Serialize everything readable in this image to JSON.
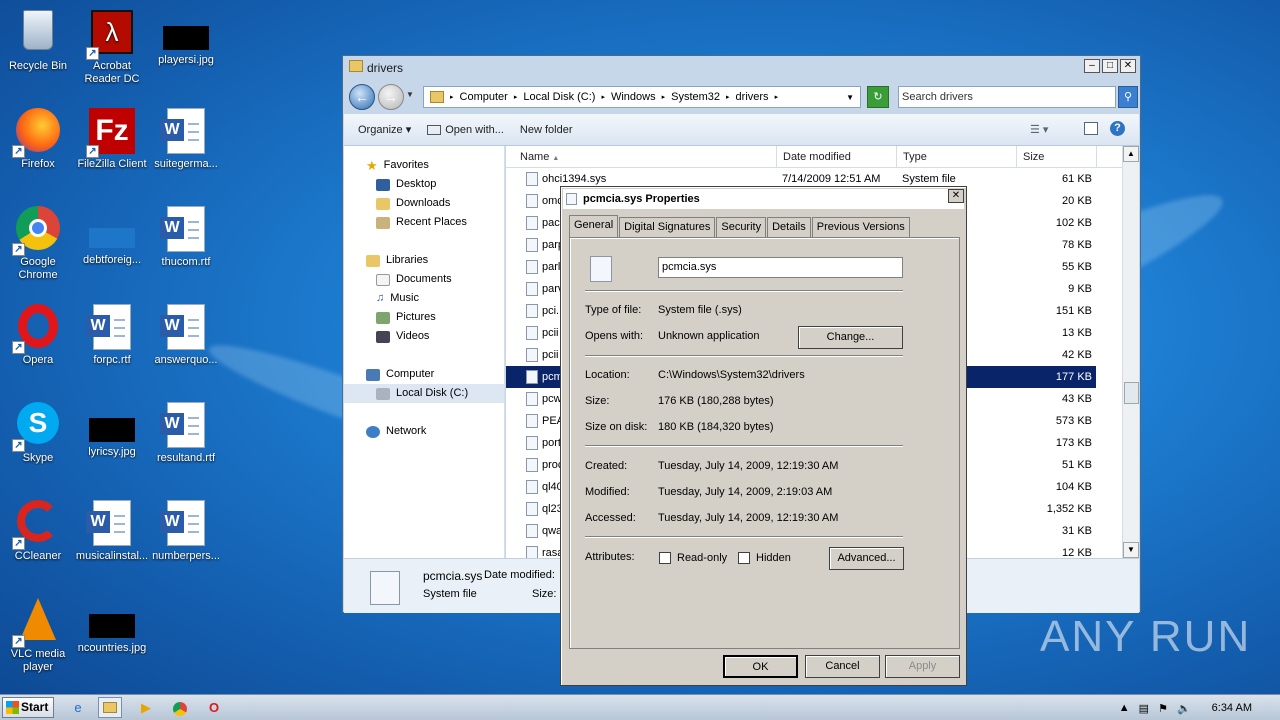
{
  "desktop": {
    "icons": [
      {
        "label": "Recycle Bin"
      },
      {
        "label": "Acrobat Reader DC"
      },
      {
        "label": "playersi.jpg"
      },
      {
        "label": "Firefox"
      },
      {
        "label": "FileZilla Client"
      },
      {
        "label": "suitegerma..."
      },
      {
        "label": "Google Chrome"
      },
      {
        "label": "debtforeig..."
      },
      {
        "label": "thucom.rtf"
      },
      {
        "label": "Opera"
      },
      {
        "label": "forpc.rtf"
      },
      {
        "label": "answerquo..."
      },
      {
        "label": "Skype"
      },
      {
        "label": "lyricsy.jpg"
      },
      {
        "label": "resultand.rtf"
      },
      {
        "label": "CCleaner"
      },
      {
        "label": "musicalinstal..."
      },
      {
        "label": "numberpers..."
      },
      {
        "label": "VLC media player"
      },
      {
        "label": "ncountries.jpg"
      }
    ]
  },
  "explorer": {
    "title": "drivers",
    "breadcrumb": [
      "Computer",
      "Local Disk (C:)",
      "Windows",
      "System32",
      "drivers"
    ],
    "search_placeholder": "Search drivers",
    "toolbar": {
      "organize": "Organize",
      "open_with": "Open with...",
      "new_folder": "New folder"
    },
    "nav": {
      "favorites": "Favorites",
      "desktop": "Desktop",
      "downloads": "Downloads",
      "recent": "Recent Places",
      "libraries": "Libraries",
      "documents": "Documents",
      "music": "Music",
      "pictures": "Pictures",
      "videos": "Videos",
      "computer": "Computer",
      "local_disk": "Local Disk (C:)",
      "network": "Network"
    },
    "columns": {
      "name": "Name",
      "date": "Date modified",
      "type": "Type",
      "size": "Size"
    },
    "rows": [
      {
        "name": "ohci1394.sys",
        "date": "7/14/2009 12:51 AM",
        "type": "System file",
        "size": "61 KB"
      },
      {
        "name": "omc",
        "date": "",
        "type": "",
        "size": "20 KB"
      },
      {
        "name": "pac",
        "date": "",
        "type": "",
        "size": "102 KB"
      },
      {
        "name": "parp",
        "date": "",
        "type": "",
        "size": "78 KB"
      },
      {
        "name": "parl",
        "date": "",
        "type": "",
        "size": "55 KB"
      },
      {
        "name": "parv",
        "date": "",
        "type": "",
        "size": "9 KB"
      },
      {
        "name": "pci.",
        "date": "",
        "type": "",
        "size": "151 KB"
      },
      {
        "name": "pcii",
        "date": "",
        "type": "",
        "size": "13 KB"
      },
      {
        "name": "pcii",
        "date": "",
        "type": "",
        "size": "42 KB"
      },
      {
        "name": "pcm",
        "date": "",
        "type": "",
        "size": "177 KB"
      },
      {
        "name": "pcw",
        "date": "",
        "type": "",
        "size": "43 KB"
      },
      {
        "name": "PEA",
        "date": "",
        "type": "",
        "size": "573 KB"
      },
      {
        "name": "port",
        "date": "",
        "type": "",
        "size": "173 KB"
      },
      {
        "name": "proc",
        "date": "",
        "type": "",
        "size": "51 KB"
      },
      {
        "name": "ql40",
        "date": "",
        "type": "",
        "size": "104 KB"
      },
      {
        "name": "ql23",
        "date": "",
        "type": "",
        "size": "1,352 KB"
      },
      {
        "name": "qwa",
        "date": "",
        "type": "",
        "size": "31 KB"
      },
      {
        "name": "rasa",
        "date": "",
        "type": "",
        "size": "12 KB"
      }
    ],
    "details": {
      "name": "pcmcia.sys",
      "date_label": "Date modified:",
      "type": "System file",
      "size_label": "Size:"
    }
  },
  "dialog": {
    "title": "pcmcia.sys Properties",
    "tabs": [
      "General",
      "Digital Signatures",
      "Security",
      "Details",
      "Previous Versions"
    ],
    "filename": "pcmcia.sys",
    "type_label": "Type of file:",
    "type_value": "System file (.sys)",
    "opens_label": "Opens with:",
    "opens_value": "Unknown application",
    "change": "Change...",
    "location_label": "Location:",
    "location_value": "C:\\Windows\\System32\\drivers",
    "size_label": "Size:",
    "size_value": "176 KB (180,288 bytes)",
    "disk_label": "Size on disk:",
    "disk_value": "180 KB (184,320 bytes)",
    "created_label": "Created:",
    "created_value": "Tuesday, July 14, 2009, 12:19:30 AM",
    "modified_label": "Modified:",
    "modified_value": "Tuesday, July 14, 2009, 2:19:03 AM",
    "accessed_label": "Accessed:",
    "accessed_value": "Tuesday, July 14, 2009, 12:19:30 AM",
    "attributes_label": "Attributes:",
    "readonly": "Read-only",
    "hidden": "Hidden",
    "advanced": "Advanced...",
    "ok": "OK",
    "cancel": "Cancel",
    "apply": "Apply"
  },
  "taskbar": {
    "start": "Start",
    "clock": "6:34 AM"
  },
  "watermark": "ANY RUN"
}
